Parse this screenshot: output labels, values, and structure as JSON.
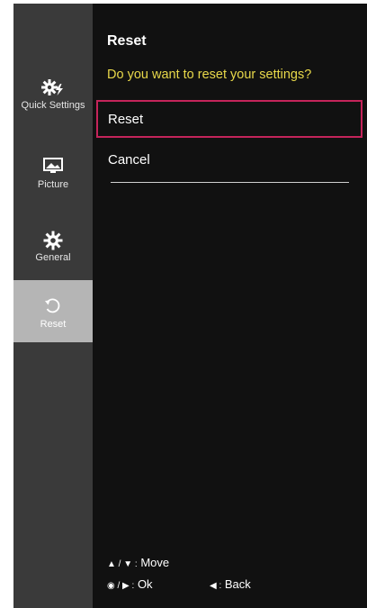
{
  "sidebar": {
    "items": [
      {
        "label": "Quick Settings",
        "icon": "gear-bolt-icon",
        "active": false
      },
      {
        "label": "Picture",
        "icon": "picture-icon",
        "active": false
      },
      {
        "label": "General",
        "icon": "gear-icon",
        "active": false
      },
      {
        "label": "Reset",
        "icon": "reset-icon",
        "active": true
      }
    ]
  },
  "main": {
    "title": "Reset",
    "question": "Do you want to reset your settings?",
    "options": [
      {
        "label": "Reset",
        "selected": true
      },
      {
        "label": "Cancel",
        "selected": false
      }
    ]
  },
  "guide": {
    "move_symbols": "▲ / ▼ :",
    "move_label": "Move",
    "ok_symbols": "◉ / ▶ :",
    "ok_label": "Ok",
    "back_symbol": "◀ :",
    "back_label": "Back"
  },
  "colors": {
    "panel": "#111111",
    "sidebar": "#3a3a3a",
    "active_item": "#b5b5b5",
    "question_text": "#e8d84a",
    "selection_border": "#c4245a"
  }
}
